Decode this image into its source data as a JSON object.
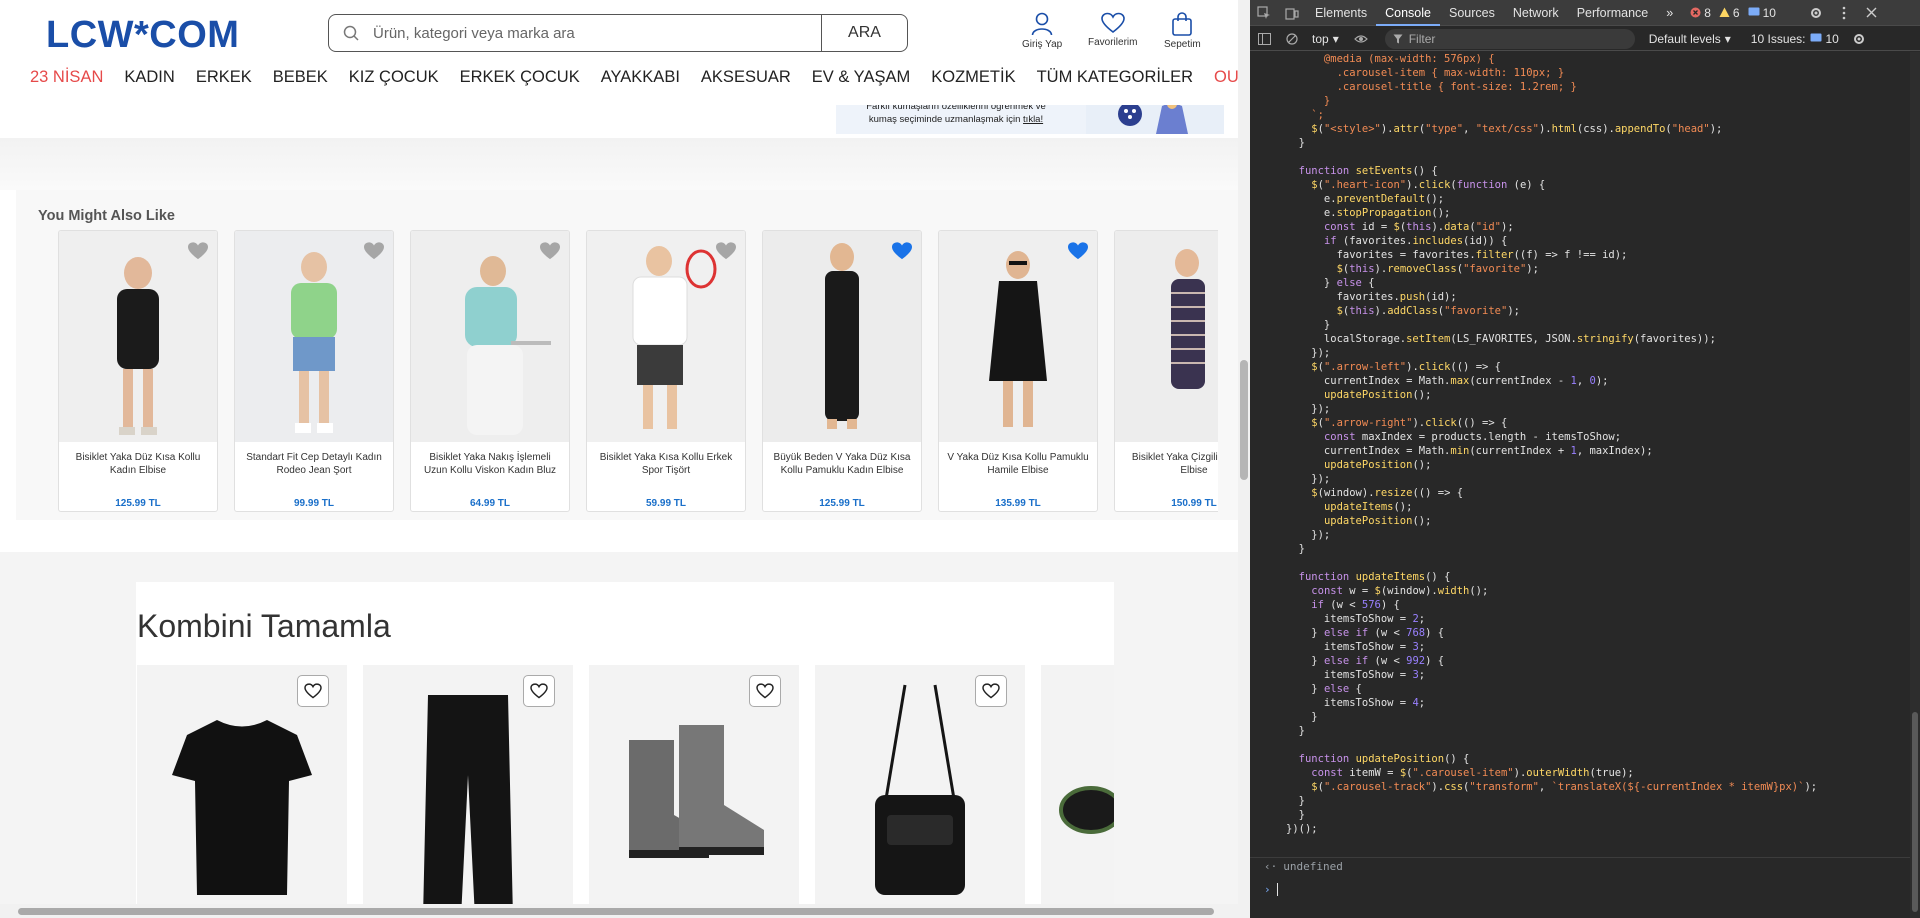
{
  "site": {
    "logo": "LCW*COM",
    "search": {
      "placeholder": "Ürün, kategori veya marka ara",
      "button": "ARA"
    },
    "header_icons": {
      "login": "Giriş Yap",
      "favorites": "Favorilerim",
      "cart": "Sepetim"
    },
    "nav": [
      "23 NİSAN",
      "KADIN",
      "ERKEK",
      "BEBEK",
      "KIZ ÇOCUK",
      "ERKEK ÇOCUK",
      "AYAKKABI",
      "AKSESUAR",
      "EV & YAŞAM",
      "KOZMETİK",
      "TÜM KATEGORİLER",
      "OUTLET"
    ],
    "banner": {
      "line1": "Farklı kumaşların özelliklerini öğrenmek ve",
      "line2": "kumaş seçiminde uzmanlaşmak için ",
      "link": "tıkla!"
    },
    "you_might_also_like": {
      "title": "You Might Also Like",
      "products": [
        {
          "name": "Bisiklet Yaka Düz Kısa Kollu Kadın Elbise",
          "price": "125.99 TL",
          "favorite": false,
          "colors": [
            "#efefef",
            "#1b1b1b",
            "#d9d3c9"
          ]
        },
        {
          "name": "Standart Fit Cep Detaylı Kadın Rodeo Jean Şort",
          "price": "99.99 TL",
          "favorite": false,
          "colors": [
            "#ecedef",
            "#8fd38a",
            "#6f98c9"
          ]
        },
        {
          "name": "Bisiklet Yaka Nakış İşlemeli Uzun Kollu Viskon Kadın Bluz",
          "price": "64.99 TL",
          "favorite": false,
          "colors": [
            "#eeeeee",
            "#8fd0cf",
            "#efefef"
          ]
        },
        {
          "name": "Bisiklet Yaka Kısa Kollu Erkek Spor Tişört",
          "price": "59.99 TL",
          "favorite": false,
          "colors": [
            "#f0f0f0",
            "#ffffff",
            "#3b3b3b"
          ]
        },
        {
          "name": "Büyük Beden V Yaka Düz Kısa Kollu Pamuklu Kadın Elbise",
          "price": "125.99 TL",
          "favorite": true,
          "colors": [
            "#ececec",
            "#1a1a1a",
            "#1a1a1a"
          ]
        },
        {
          "name": "V Yaka Düz Kısa Kollu Pamuklu Hamile Elbise",
          "price": "135.99 TL",
          "favorite": true,
          "colors": [
            "#efefef",
            "#151515",
            "#151515"
          ]
        },
        {
          "name": "Bisiklet Yaka Çizgili K Kadın Elbise",
          "price": "150.99 TL",
          "favorite": false,
          "colors": [
            "#ededed",
            "#3a3350",
            "#c9b7b0"
          ]
        }
      ]
    },
    "kombin": {
      "title": "Kombini Tamamla",
      "items": [
        {
          "icon": "tshirt-icon",
          "color": "#111111"
        },
        {
          "icon": "pants-icon",
          "color": "#141414"
        },
        {
          "icon": "boots-icon",
          "color": "#6b6b6b"
        },
        {
          "icon": "bag-icon",
          "color": "#151515"
        },
        {
          "icon": "sunglasses-icon",
          "color": "#1a1a1a"
        }
      ]
    }
  },
  "devtools": {
    "tabs": [
      "Elements",
      "Console",
      "Sources",
      "Network",
      "Performance"
    ],
    "active_tab": "Console",
    "errors": "8",
    "warnings": "6",
    "info": "10",
    "context": "top",
    "filter_placeholder": "Filter",
    "levels": "Default levels",
    "issues": "10 Issues:",
    "issues_count": "10",
    "console_output": "undefined",
    "code_lines": [
      "      @media (max-width: 576px) {",
      "        .carousel-item { max-width: 110px; }",
      "        .carousel-title { font-size: 1.2rem; }",
      "      }",
      "    `;",
      "    $(\"<style>\").attr(\"type\", \"text/css\").html(css).appendTo(\"head\");",
      "  }",
      "",
      "  function setEvents() {",
      "    $(\".heart-icon\").click(function (e) {",
      "      e.preventDefault();",
      "      e.stopPropagation();",
      "      const id = $(this).data(\"id\");",
      "      if (favorites.includes(id)) {",
      "        favorites = favorites.filter((f) => f !== id);",
      "        $(this).removeClass(\"favorite\");",
      "      } else {",
      "        favorites.push(id);",
      "        $(this).addClass(\"favorite\");",
      "      }",
      "      localStorage.setItem(LS_FAVORITES, JSON.stringify(favorites));",
      "    });",
      "    $(\".arrow-left\").click(() => {",
      "      currentIndex = Math.max(currentIndex - 1, 0);",
      "      updatePosition();",
      "    });",
      "    $(\".arrow-right\").click(() => {",
      "      const maxIndex = products.length - itemsToShow;",
      "      currentIndex = Math.min(currentIndex + 1, maxIndex);",
      "      updatePosition();",
      "    });",
      "    $(window).resize(() => {",
      "      updateItems();",
      "      updatePosition();",
      "    });",
      "  }",
      "",
      "  function updateItems() {",
      "    const w = $(window).width();",
      "    if (w < 576) {",
      "      itemsToShow = 2;",
      "    } else if (w < 768) {",
      "      itemsToShow = 3;",
      "    } else if (w < 992) {",
      "      itemsToShow = 3;",
      "    } else {",
      "      itemsToShow = 4;",
      "    }",
      "  }",
      "",
      "  function updatePosition() {",
      "    const itemW = $(\".carousel-item\").outerWidth(true);",
      "    $(\".carousel-track\").css(\"transform\", `translateX(${-currentIndex * itemW}px)`);",
      "  }",
      "  }",
      "})();"
    ]
  }
}
